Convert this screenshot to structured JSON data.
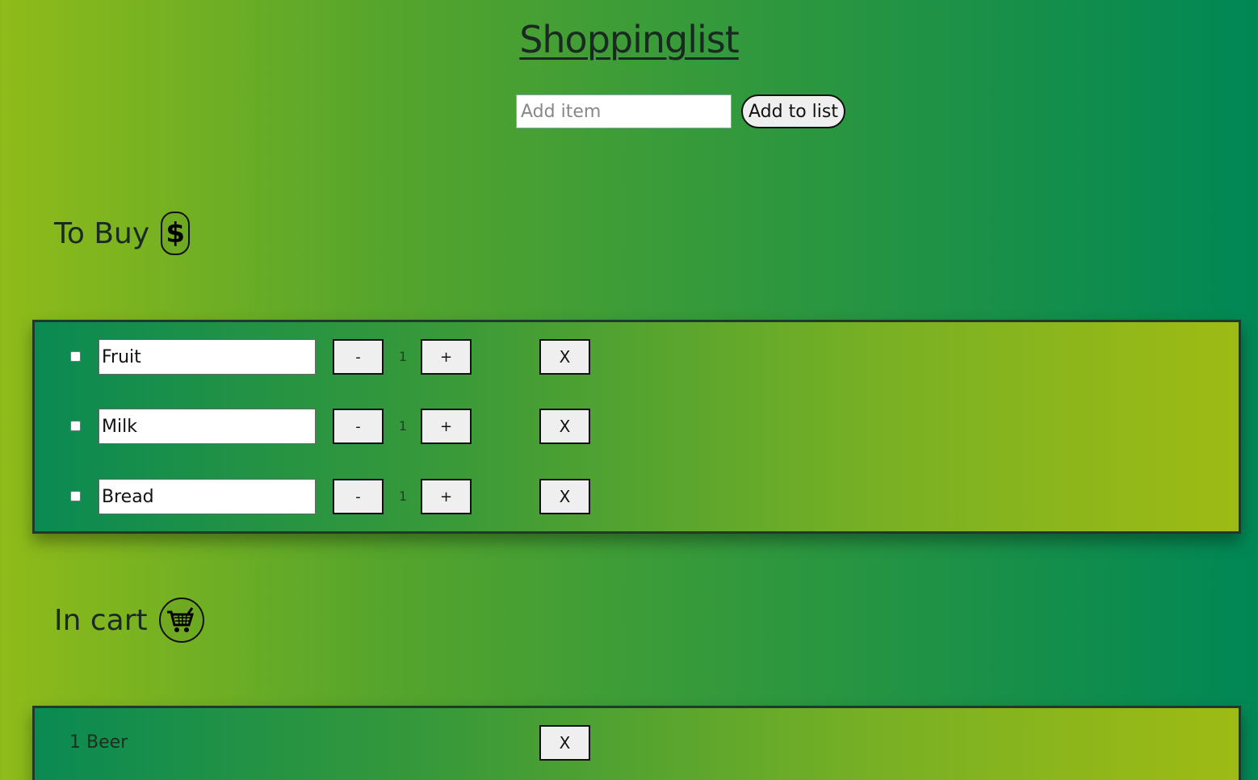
{
  "header": {
    "title": "Shoppinglist"
  },
  "add_form": {
    "placeholder": "Add item",
    "value": "",
    "button_label": "Add to list"
  },
  "to_buy": {
    "heading": "To Buy",
    "icon": "dollar-icon",
    "items": [
      {
        "name": "Fruit",
        "checked": false,
        "quantity": "1",
        "minus_label": "-",
        "plus_label": "+",
        "remove_label": "X"
      },
      {
        "name": "Milk",
        "checked": false,
        "quantity": "1",
        "minus_label": "-",
        "plus_label": "+",
        "remove_label": "X"
      },
      {
        "name": "Bread",
        "checked": false,
        "quantity": "1",
        "minus_label": "-",
        "plus_label": "+",
        "remove_label": "X"
      }
    ]
  },
  "in_cart": {
    "heading": "In cart",
    "icon": "cart-icon",
    "items": [
      {
        "text": "1 Beer",
        "remove_label": "X"
      }
    ]
  },
  "colors": {
    "bg_left": "#8fbb1a",
    "bg_right": "#008755",
    "panel_left": "#0a8a52",
    "panel_right": "#9ebb14"
  }
}
